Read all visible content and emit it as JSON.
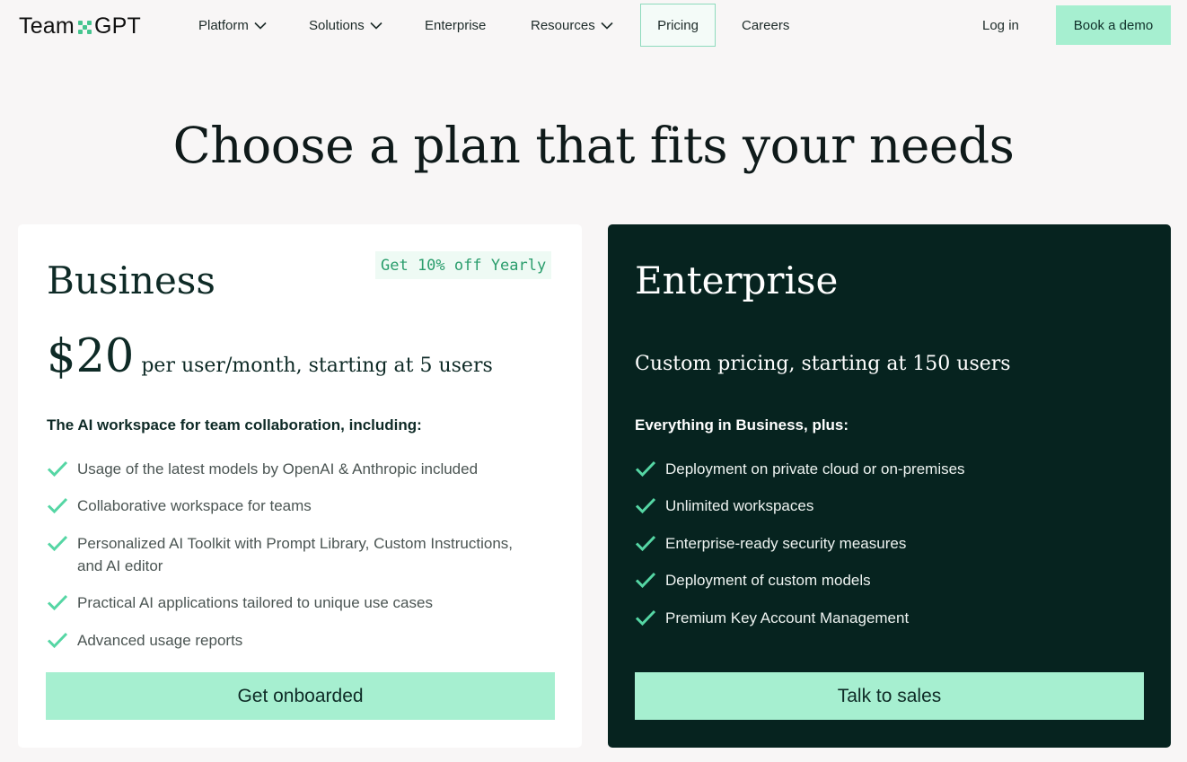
{
  "nav": {
    "logo_left": "Team",
    "logo_right": "GPT",
    "items": [
      {
        "label": "Platform",
        "dropdown": true
      },
      {
        "label": "Solutions",
        "dropdown": true
      },
      {
        "label": "Enterprise",
        "dropdown": false
      },
      {
        "label": "Resources",
        "dropdown": true
      },
      {
        "label": "Pricing",
        "dropdown": false,
        "active": true
      },
      {
        "label": "Careers",
        "dropdown": false
      }
    ],
    "login": "Log in",
    "demo": "Book a demo"
  },
  "heading": "Choose a plan that fits your needs",
  "business": {
    "title": "Business",
    "badge": "Get 10% off Yearly",
    "price": "$20",
    "price_suffix": "per user/month, starting at 5 users",
    "intro": "The AI workspace for team collaboration, including:",
    "features": [
      "Usage of the latest models by OpenAI & Anthropic included",
      "Collaborative workspace for teams",
      "Personalized AI Toolkit with Prompt Library, Custom Instructions, and AI editor",
      "Practical AI applications tailored to unique use cases",
      "Advanced usage reports"
    ],
    "cta": "Get onboarded"
  },
  "enterprise": {
    "title": "Enterprise",
    "price_text": "Custom pricing, starting at 150 users",
    "intro": "Everything in Business, plus:",
    "features": [
      "Deployment on private cloud or on-premises",
      "Unlimited workspaces",
      "Enterprise-ready security measures",
      "Deployment of custom models",
      "Premium Key Account Management"
    ],
    "cta": "Talk to sales"
  },
  "colors": {
    "accent": "#a6efd0",
    "check": "#55d6a4",
    "enterprise_bg": "#06231f",
    "page_bg": "#f8f6f6"
  }
}
